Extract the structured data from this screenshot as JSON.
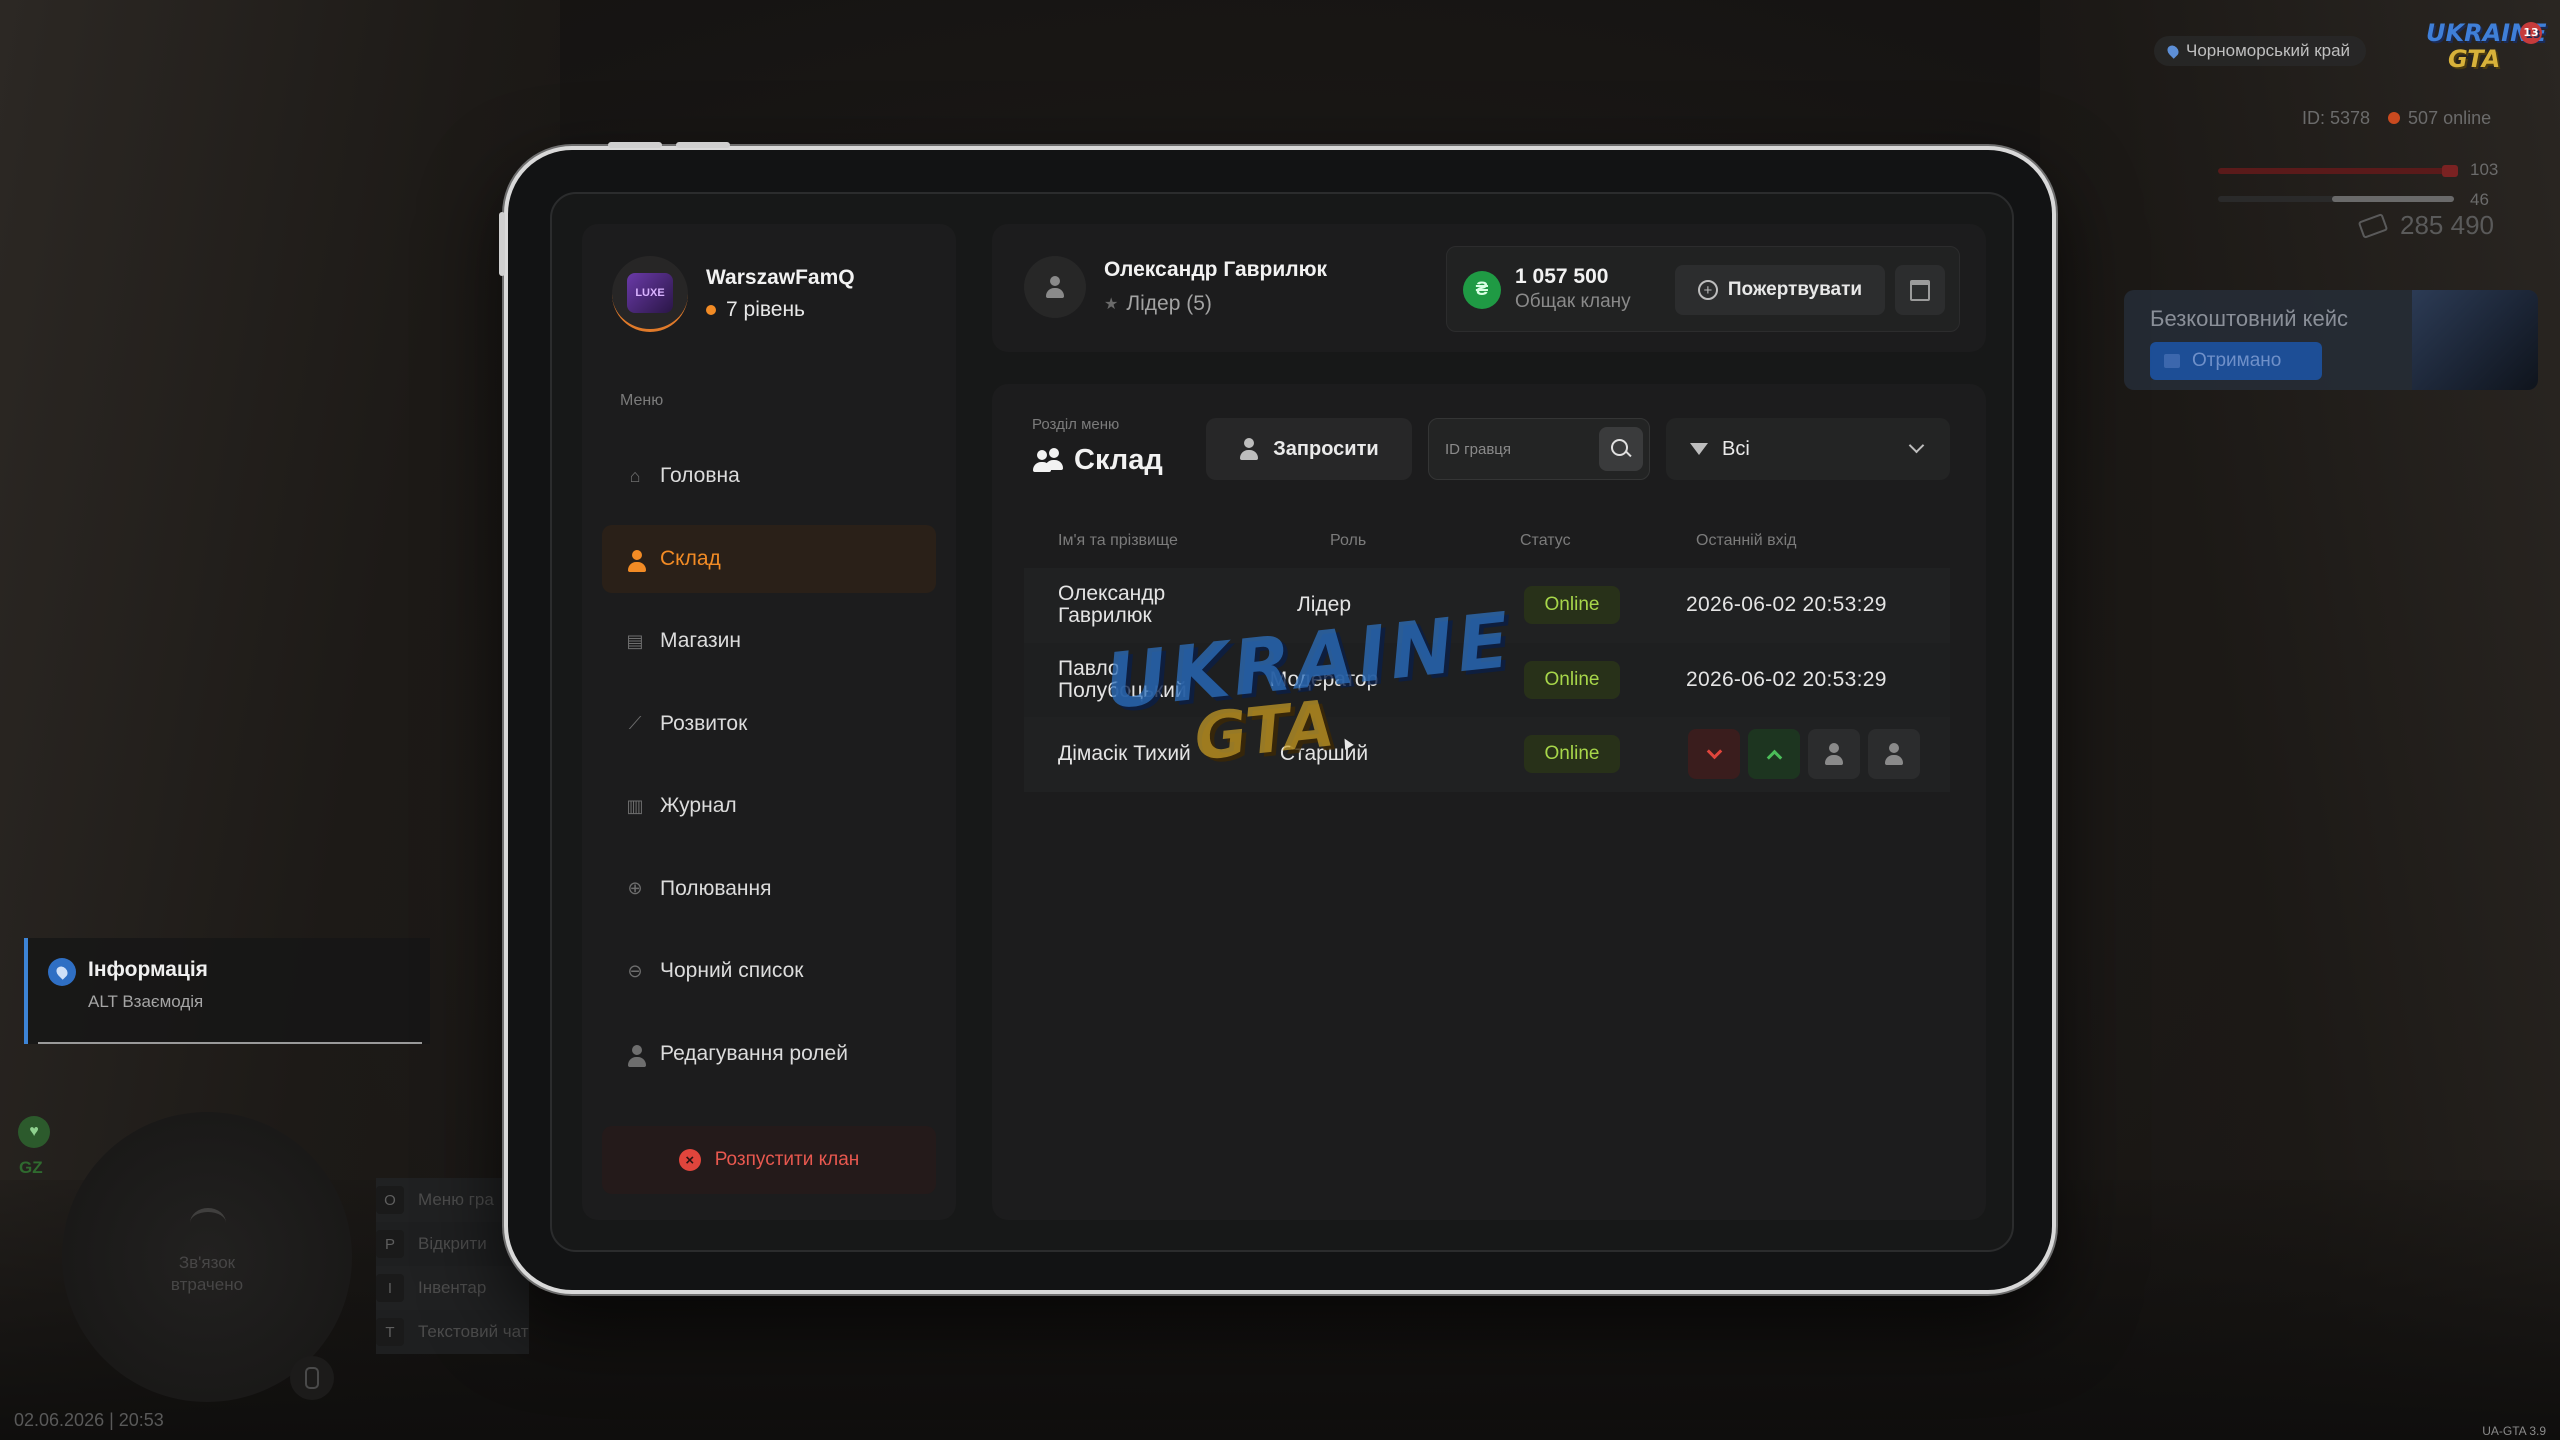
{
  "hud": {
    "server_name": "Чорноморський край",
    "logo_line1": "UKRAINE",
    "logo_line2": "GTA",
    "logo_badge": "13",
    "player_id": "ID: 5378",
    "online": "507 online",
    "health_value": "103",
    "armor_value": "46",
    "money": "285 490",
    "free_case_title": "Безкоштовний кейс",
    "free_case_status": "Отримано",
    "info_title": "Інформація",
    "info_hint": "ALT Взаємодія",
    "gz_label": "GZ",
    "minimap_message": "Зв'язок втрачено",
    "keys": [
      {
        "key": "O",
        "label": "Меню гра"
      },
      {
        "key": "P",
        "label": "Відкрити"
      },
      {
        "key": "I",
        "label": "Інвентар"
      },
      {
        "key": "T",
        "label": "Текстовий чат"
      }
    ],
    "datetime": "02.06.2026 | 20:53",
    "version": "UA-GTA 3.9",
    "colors": {
      "accent_blue": "#3d84d6",
      "gold": "#d8b23a"
    }
  },
  "sidebar": {
    "clan_name": "WarszawFamQ",
    "clan_level": "7 рівень",
    "avatar_text": "LUXE",
    "menu_caption": "Меню",
    "items": [
      {
        "label": "Головна",
        "icon": "home-icon",
        "active": false
      },
      {
        "label": "Склад",
        "icon": "users-icon",
        "active": true
      },
      {
        "label": "Магазин",
        "icon": "shop-icon",
        "active": false
      },
      {
        "label": "Розвиток",
        "icon": "chart-icon",
        "active": false
      },
      {
        "label": "Журнал",
        "icon": "book-icon",
        "active": false
      },
      {
        "label": "Полювання",
        "icon": "crosshair-icon",
        "active": false
      },
      {
        "label": "Чорний список",
        "icon": "block-icon",
        "active": false
      },
      {
        "label": "Редагування ролей",
        "icon": "user-edit-icon",
        "active": false
      }
    ],
    "disband_label": "Розпустити клан"
  },
  "header": {
    "user_name": "Олександр Гаврилюк",
    "user_role": "Лідер (5)",
    "bank_amount": "1 057 500",
    "bank_label": "Общак клану",
    "donate_label": "Пожертвувати"
  },
  "content": {
    "section_caption": "Розділ меню",
    "section_title": "Склад",
    "invite_label": "Запросити",
    "search": {
      "placeholder": "ID гравця",
      "value": ""
    },
    "filter": {
      "selected": "Всі"
    },
    "columns": [
      "Ім'я та прізвище",
      "Роль",
      "Статус",
      "Останній вхід"
    ],
    "members": [
      {
        "name": "Олександр Гаврилюк",
        "role": "Лідер",
        "status": "Online",
        "last_login": "2026-06-02 20:53:29"
      },
      {
        "name": "Павло Полубоцький",
        "role": "Модератор",
        "status": "Online",
        "last_login": "2026-06-02 20:53:29"
      },
      {
        "name": "Дімасік Тихий",
        "role": "Старший",
        "status": "Online",
        "last_login": ""
      }
    ],
    "colors": {
      "accent": "#f28b25",
      "online": "#a7d64a",
      "danger": "#e0453c",
      "success": "#4bbd59"
    }
  },
  "watermark": {
    "line1": "UKRAINE",
    "line2": "GTA"
  }
}
